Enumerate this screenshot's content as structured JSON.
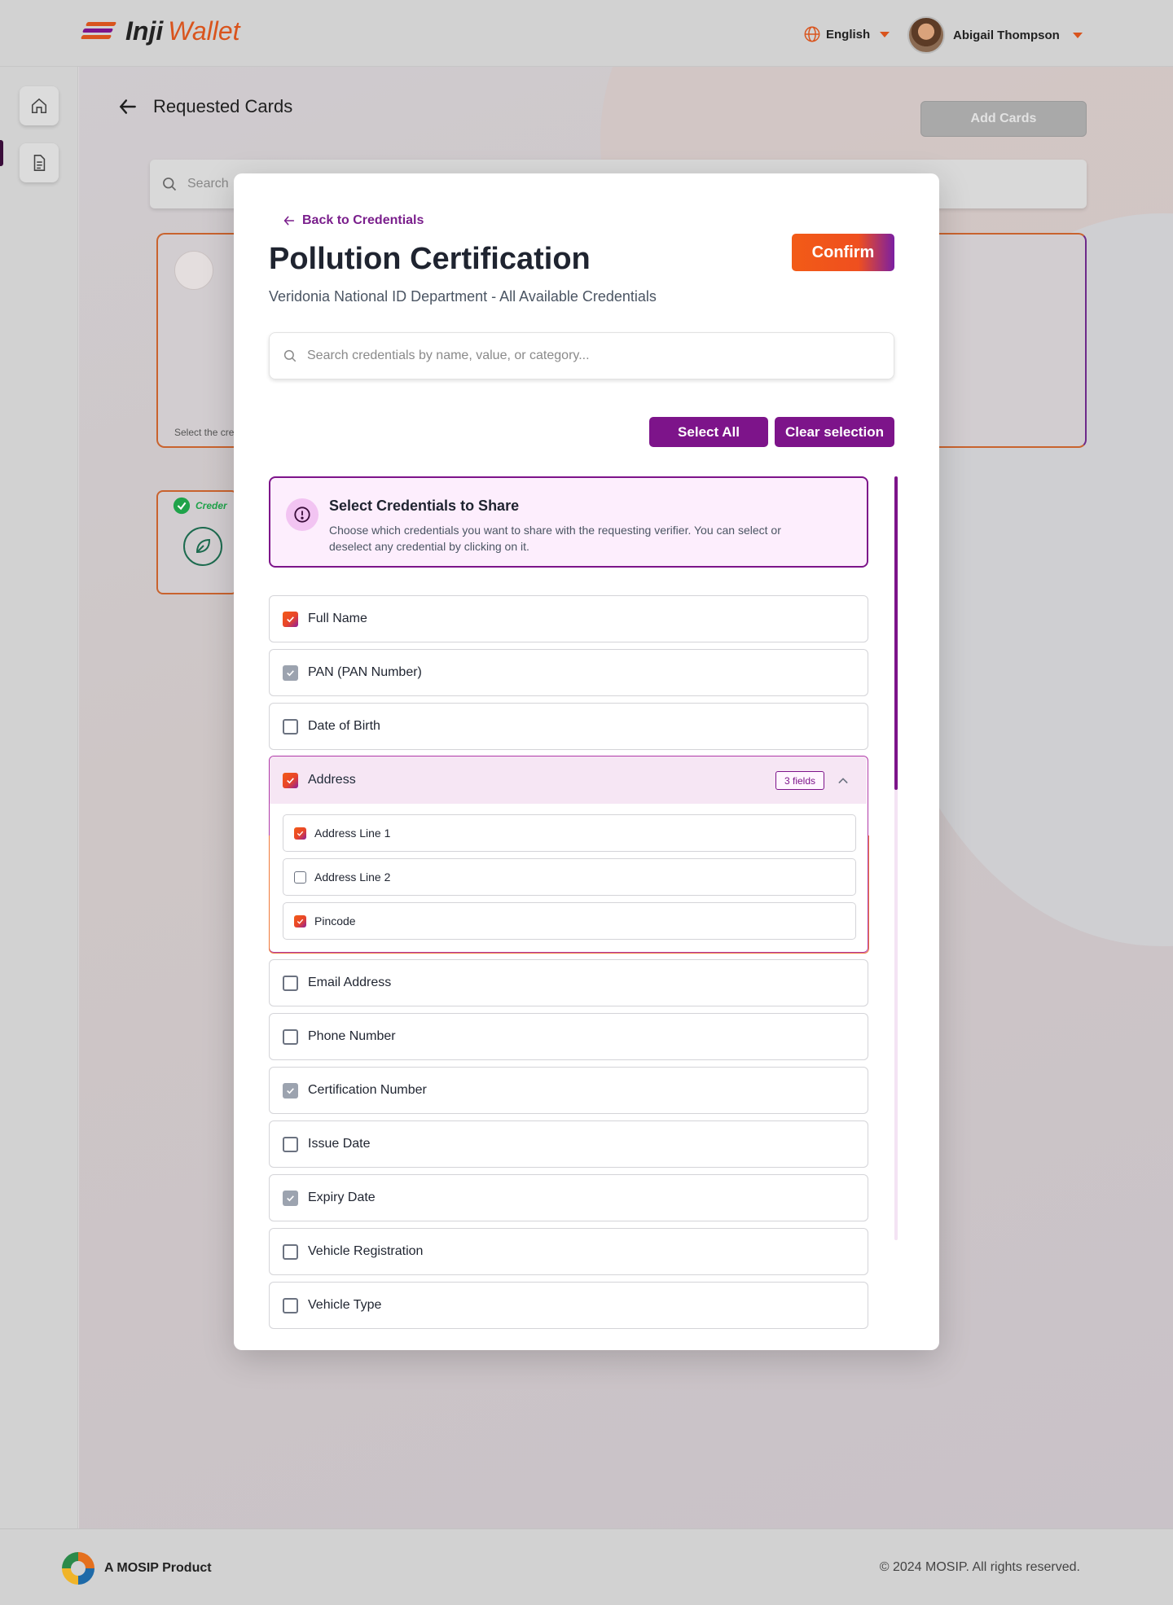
{
  "header": {
    "logo_primary": "Inji",
    "logo_secondary": "Wallet",
    "language": "English",
    "user_name": "Abigail Thompson"
  },
  "page": {
    "title": "Requested Cards",
    "add_cards_label": "Add Cards",
    "search_placeholder": "Search",
    "card_footnote": "Select the cre",
    "card2_label": "Creder"
  },
  "footer": {
    "product": "A MOSIP Product",
    "copyright": "© 2024 MOSIP. All rights reserved."
  },
  "modal": {
    "back_label": "Back to Credentials",
    "title": "Pollution Certification",
    "subtitle": "Veridonia National ID Department - All Available Credentials",
    "confirm_label": "Confirm",
    "search_placeholder": "Search credentials by name, value, or category...",
    "select_all_label": "Select All",
    "clear_label": "Clear selection",
    "info": {
      "title": "Select Credentials to Share",
      "text": "Choose which credentials you want to share with the requesting verifier. You can select or deselect any credential by clicking on it."
    },
    "credentials": [
      {
        "label": "Full Name",
        "state": "checked"
      },
      {
        "label": "PAN (PAN Number)",
        "state": "mandatory"
      },
      {
        "label": "Date of Birth",
        "state": "unchecked"
      },
      {
        "label": "Address",
        "state": "checked"
      },
      {
        "label": "Email Address",
        "state": "unchecked"
      },
      {
        "label": "Phone Number",
        "state": "unchecked"
      },
      {
        "label": "Certification Number",
        "state": "mandatory"
      },
      {
        "label": "Issue Date",
        "state": "unchecked"
      },
      {
        "label": "Expiry Date",
        "state": "mandatory"
      },
      {
        "label": "Vehicle Registration",
        "state": "unchecked"
      },
      {
        "label": "Vehicle Type",
        "state": "unchecked"
      }
    ],
    "address_badge": "3 fields",
    "address_fields": [
      {
        "label": "Address Line 1",
        "state": "checked"
      },
      {
        "label": "Address Line 2",
        "state": "unchecked"
      },
      {
        "label": "Pincode",
        "state": "checked"
      }
    ]
  },
  "colors": {
    "accent_purple": "#7d148a",
    "accent_orange": "#f25b17"
  }
}
